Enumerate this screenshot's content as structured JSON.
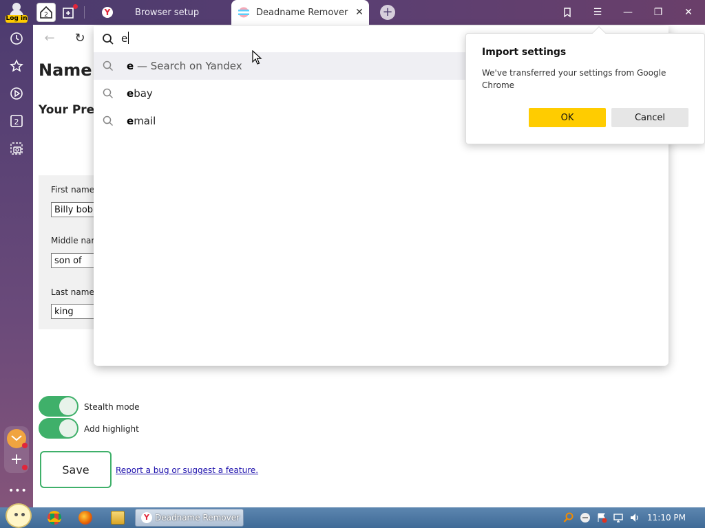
{
  "titlebar": {
    "login_badge": "Log in",
    "home_count": "2",
    "tabs": [
      {
        "label": "Browser setup"
      },
      {
        "label": "Deadname Remover Op",
        "active": true
      }
    ]
  },
  "sidebar": {
    "tab_counter": "2"
  },
  "page": {
    "title": "Name S",
    "section_title": "Your Prefe",
    "fields": {
      "first_label": "First name:",
      "first_value": "Billy bob t",
      "middle_label": "Middle nam",
      "middle_value": "son of",
      "last_label": "Last name:",
      "last_value": "king"
    },
    "toggles": {
      "stealth_label": "Stealth mode",
      "stealth_on": true,
      "highlight_label": "Add highlight",
      "highlight_on": true
    },
    "save_label": "Save",
    "report_link": "Report a bug or suggest a feature."
  },
  "omnibox": {
    "query": "e",
    "suggestions": [
      {
        "bold": "e",
        "rest": " — Search on Yandex",
        "highlighted": true
      },
      {
        "bold": "e",
        "rest": "bay"
      },
      {
        "bold": "e",
        "rest": "mail"
      }
    ]
  },
  "popup": {
    "title": "Import settings",
    "message": "We've transferred your settings from Google Chrome",
    "ok_label": "OK",
    "cancel_label": "Cancel"
  },
  "taskbar": {
    "task_label": "Deadname Remover ...",
    "clock": "11:10 PM"
  },
  "colors": {
    "accent_yellow": "#ffcc00",
    "toggle_green": "#3fb06a",
    "yandex_red": "#e0263b"
  }
}
